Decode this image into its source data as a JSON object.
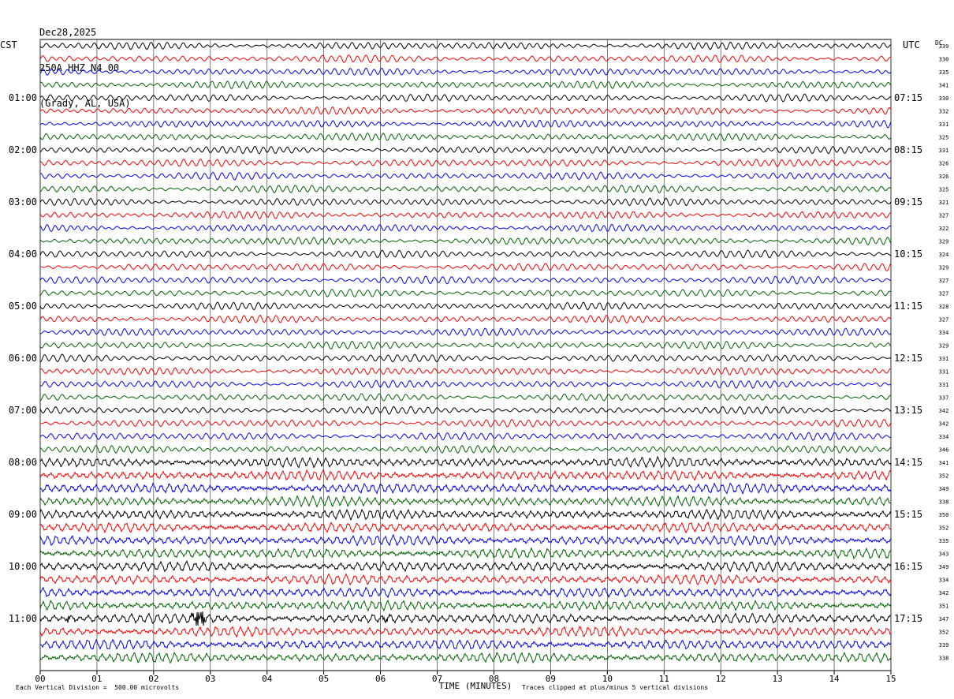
{
  "header": {
    "date": "Dec28,2025",
    "station": "250A HHZ N4 00",
    "location": "(Grady, AL, USA)"
  },
  "left_label": "CST",
  "right_label": "UTC",
  "dc_label": "DC",
  "footer": {
    "scale_note": "Each Vertical Division =  500.00 microvolts",
    "clip_note": "Traces clipped at plus/minus 5 vertical divisions"
  },
  "chart_data": {
    "type": "line",
    "xlabel": "TIME (MINUTES)",
    "xlim": [
      0,
      15
    ],
    "x_ticks": [
      "00",
      "01",
      "02",
      "03",
      "04",
      "05",
      "06",
      "07",
      "08",
      "09",
      "10",
      "11",
      "12",
      "13",
      "14",
      "15"
    ],
    "trace_colors": [
      "#000000",
      "#ff0000",
      "#0000ff",
      "#006400"
    ],
    "rows_per_hour": 4,
    "cst_labels": [
      "01:00",
      "02:00",
      "03:00",
      "04:00",
      "05:00",
      "06:00",
      "07:00",
      "08:00",
      "09:00",
      "10:00",
      "11:00"
    ],
    "utc_labels": [
      "07:15",
      "08:15",
      "09:15",
      "10:15",
      "11:15",
      "12:15",
      "13:15",
      "14:15",
      "15:15",
      "16:15",
      "17:15"
    ],
    "dc_offsets": [
      339,
      330,
      335,
      341,
      330,
      332,
      331,
      325,
      331,
      326,
      326,
      325,
      321,
      327,
      322,
      329,
      324,
      329,
      327,
      327,
      328,
      327,
      334,
      329,
      331,
      331,
      331,
      337,
      342,
      342,
      334,
      346,
      341,
      352,
      349,
      338,
      350,
      352,
      335,
      343,
      349,
      334,
      342,
      351,
      347,
      352,
      339,
      338
    ],
    "events": [
      {
        "row": 44,
        "minute": 2.8,
        "note": "large burst"
      },
      {
        "row": 44,
        "minute": 6.1,
        "note": "small burst"
      },
      {
        "row": 44,
        "minute": 0.5,
        "note": "small burst"
      }
    ]
  }
}
